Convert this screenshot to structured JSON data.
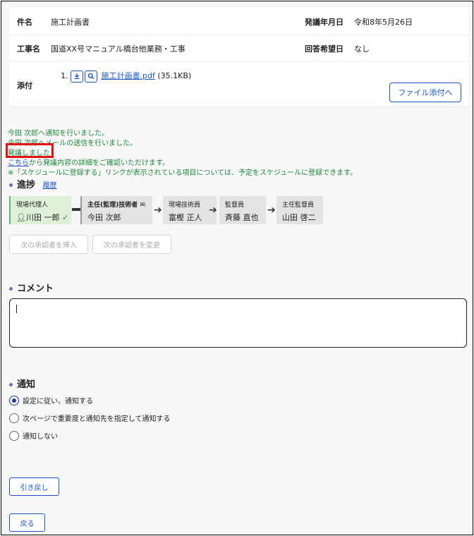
{
  "info": {
    "subject_label": "件名",
    "subject_value": "施工計画書",
    "date_label": "発議年月日",
    "date_value": "令和8年5月26日",
    "project_label": "工事名",
    "project_value": "国道XX号マニュアル橋台他業務・工事",
    "reply_label": "回答希望日",
    "reply_value": "なし",
    "attach_label": "添付",
    "attach_index": "1.",
    "attach_file": "施工計画書.pdf",
    "attach_size": "(35.1KB)",
    "attach_button": "ファイル添付へ"
  },
  "messages": {
    "line1": "今田 次郎へ通知を行いました。",
    "line2": "今田 次郎へメールの送信を行いました。",
    "line3": "発議しました",
    "line4_link": "こちら",
    "line4_rest": "から発議内容の詳細をご確認いただけます。",
    "line5": "※「スケジュールに登録する」リンクが表示されている項目については、予定をスケジュールに登録できます。"
  },
  "progress": {
    "title": "進捗",
    "history_link": "履歴",
    "steps": [
      {
        "role": "現場代理人",
        "name": "川田 一郎"
      },
      {
        "role": "主任(監理)技術者",
        "name": "今田 次郎"
      },
      {
        "role": "現場技術員",
        "name": "富樫 正人"
      },
      {
        "role": "監督員",
        "name": "斉藤 直也"
      },
      {
        "role": "主任監督員",
        "name": "山田 啓二"
      }
    ],
    "insert_button": "次の承認者を挿入",
    "change_button": "次の承認者を変更"
  },
  "comment": {
    "title": "コメント",
    "value": ""
  },
  "notify": {
    "title": "通知",
    "options": [
      "設定に従い、通知する",
      "次ページで重要度と通知先を指定して通知する",
      "通知しない"
    ],
    "selected": 0
  },
  "actions": {
    "pullback": "引き戻し",
    "back": "戻る"
  },
  "colors": {
    "accent": "#1a55c8",
    "success": "#1c8a3c",
    "highlight": "#e01212",
    "step_active": "#dff0d8"
  }
}
